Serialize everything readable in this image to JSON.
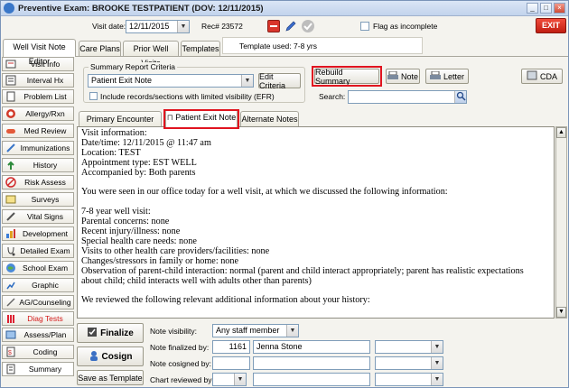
{
  "window": {
    "title": "Preventive Exam: BROOKE TESTPATIENT (DOV: 12/11/2015)"
  },
  "header": {
    "visit_date_label": "Visit date:",
    "visit_date": "12/11/2015",
    "rec_label": "Rec# 23572",
    "flag_label": "Flag as incomplete",
    "exit_label": "EXIT"
  },
  "tabs_top": {
    "items": [
      "Well Visit Note Editor",
      "Care Plans",
      "Prior Well Visits",
      "Templates"
    ],
    "template_used": "Template used:  7-8 yrs"
  },
  "sidebar": {
    "items": [
      {
        "label": "Visit Info",
        "icon": "visit-info-icon"
      },
      {
        "label": "Interval Hx",
        "icon": "interval-hx-icon"
      },
      {
        "label": "Problem List",
        "icon": "problem-list-icon"
      },
      {
        "label": "Allergy/Rxn",
        "icon": "allergy-icon"
      },
      {
        "label": "Med Review",
        "icon": "med-review-icon"
      },
      {
        "label": "Immunizations",
        "icon": "syringe-icon"
      },
      {
        "label": "History",
        "icon": "history-icon"
      },
      {
        "label": "Risk Assess",
        "icon": "risk-assess-icon"
      },
      {
        "label": "Surveys",
        "icon": "surveys-icon"
      },
      {
        "label": "Vital Signs",
        "icon": "vital-signs-icon"
      },
      {
        "label": "Development",
        "icon": "development-icon"
      },
      {
        "label": "Detailed Exam",
        "icon": "detailed-exam-icon"
      },
      {
        "label": "School Exam",
        "icon": "school-exam-icon"
      },
      {
        "label": "Graphic",
        "icon": "graphic-icon"
      },
      {
        "label": "AG/Counseling",
        "icon": "counseling-icon"
      },
      {
        "label": "Diag Tests",
        "icon": "diag-tests-icon"
      },
      {
        "label": "Assess/Plan",
        "icon": "assess-plan-icon"
      },
      {
        "label": "Coding",
        "icon": "coding-icon"
      },
      {
        "label": "Summary",
        "icon": "summary-icon"
      }
    ]
  },
  "criteria": {
    "group_label": "Summary Report Criteria",
    "selected": "Patient Exit Note",
    "edit_label": "Edit Criteria",
    "checkbox_label": "Include records/sections with limited visibility (EFR)",
    "rebuild_label": "Rebuild Summary",
    "note_label": "Note",
    "letter_label": "Letter",
    "cda_label": "CDA",
    "search_label": "Search:"
  },
  "subtabs": [
    "Primary Encounter Note",
    "Patient Exit Note",
    "Alternate Notes"
  ],
  "note_lines": [
    "Visit information:",
    "Date/time: 12/11/2015 @ 11:47 am",
    "Location: TEST",
    "Appointment type: EST WELL",
    "Accompanied by: Both parents",
    "",
    "You were seen in our office today for a well visit, at which we discussed the following information:",
    "7-8 year well visit:",
    "Parental concerns: none",
    "Recent injury/illness: none",
    "Special health care needs:  none",
    "Visits to other health care providers/facilities:  none",
    "Changes/stressors in family or home: none",
    "Observation of parent-child interaction: normal (parent and child interact appropriately; parent has realistic expectations",
    "about child; child interacts well with adults other than parents)",
    "",
    "We reviewed the following relevant additional information about your history:"
  ],
  "bottom": {
    "finalize_label": "Finalize",
    "cosign_label": "Cosign",
    "save_template_label": "Save as Template",
    "visibility_label": "Note visibility:",
    "visibility_value": "Any staff member",
    "finalized_label": "Note finalized by:",
    "finalized_id": "1161",
    "finalized_name": "Jenna Stone",
    "cosigned_label": "Note cosigned by:",
    "chart_reviewed_label": "Chart reviewed by:"
  }
}
